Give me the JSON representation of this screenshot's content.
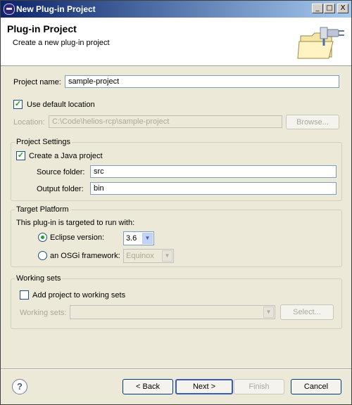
{
  "window": {
    "title": "New Plug-in Project",
    "minimize": "_",
    "maximize": "□",
    "close": "X"
  },
  "header": {
    "title": "Plug-in Project",
    "subtitle": "Create a new plug-in project",
    "banner_icon": "plugin-folder-icon"
  },
  "project": {
    "name_label": "Project name:",
    "name_value": "sample-project",
    "use_default_label": "Use default location",
    "use_default_checked": true,
    "location_label": "Location:",
    "location_value": "C:\\Code\\helios-rcp\\sample-project",
    "browse_label": "Browse..."
  },
  "settings": {
    "group_title": "Project Settings",
    "create_java_label": "Create a Java project",
    "create_java_checked": true,
    "source_label": "Source folder:",
    "source_value": "src",
    "output_label": "Output folder:",
    "output_value": "bin"
  },
  "platform": {
    "group_title": "Target Platform",
    "intro": "This plug-in is targeted to run with:",
    "eclipse_label": "Eclipse version:",
    "eclipse_selected": true,
    "eclipse_version": "3.6",
    "osgi_label": "an OSGi framework:",
    "osgi_value": "Equinox"
  },
  "working_sets": {
    "group_title": "Working sets",
    "add_label": "Add project to working sets",
    "add_checked": false,
    "sets_label": "Working sets:",
    "sets_value": "",
    "select_label": "Select..."
  },
  "footer": {
    "help": "?",
    "back": "< Back",
    "next": "Next >",
    "finish": "Finish",
    "cancel": "Cancel"
  }
}
